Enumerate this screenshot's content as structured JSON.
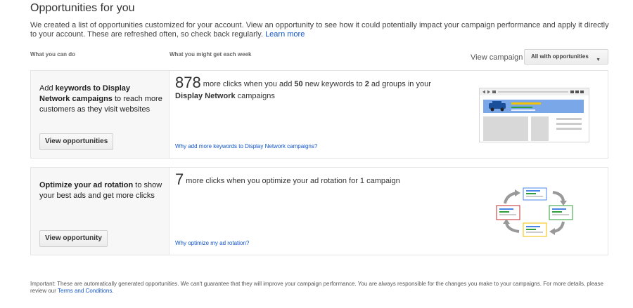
{
  "header": {
    "title": "Opportunities for you",
    "intro": "We created a list of opportunities customized for your account. View an opportunity to see how it could potentially impact your campaign performance and apply it directly to your account. These are refreshed often, so check back regularly.",
    "learn_more": "Learn more"
  },
  "columns": {
    "left": "What you can do",
    "right": "What you might get each week"
  },
  "filter": {
    "label": "View campaign",
    "selected": "All with opportunities"
  },
  "cards": [
    {
      "desc_pre": "Add ",
      "desc_bold": "keywords to Display Network campaigns",
      "desc_post": " to reach more customers as they visit websites",
      "button": "View opportunities",
      "number": "878",
      "text_1": " more clicks when you add ",
      "bold_1": "50",
      "text_2": " new keywords to ",
      "bold_2": "2",
      "text_3": " ad groups in your ",
      "bold_3": "Display Network",
      "text_4": " campaigns",
      "link": "Why add more keywords to Display Network campaigns?"
    },
    {
      "desc_pre": "",
      "desc_bold": "Optimize your ad rotation",
      "desc_post": " to show your best ads and get more clicks",
      "button": "View opportunity",
      "number": "7",
      "text_1": " more clicks when you optimize your ad rotation for 1 campaign",
      "link": "Why optimize my ad rotation?"
    }
  ],
  "footer": {
    "text": "Important: These are automatically generated opportunities. We can't guarantee that they will improve your campaign performance. You are always responsible for the changes you make to your campaigns. For more details, please review our ",
    "link": "Terms and Conditions",
    "end": "."
  },
  "colors": {
    "link": "#1155cc",
    "banner": "#7aa7e8",
    "car": "#1a4f9c",
    "red": "#c62828",
    "green": "#2e9e3a",
    "yellow": "#f2c200",
    "blue": "#4a86e8"
  }
}
